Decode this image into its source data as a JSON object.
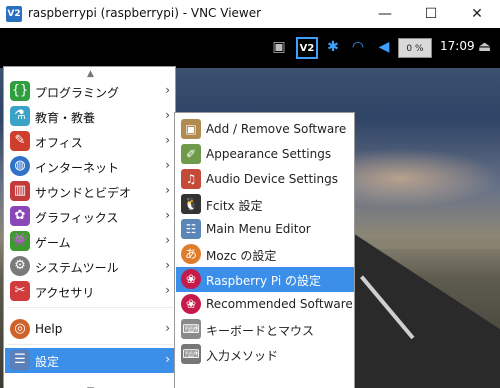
{
  "window": {
    "title": "raspberrypi (raspberrypi) - VNC Viewer",
    "app_icon_text": "V2",
    "minimize": "—",
    "maximize": "☐",
    "close": "✕"
  },
  "panel": {
    "vnc_icon_text": "V2",
    "cpu": "0 %",
    "clock": "17:09"
  },
  "main_menu": {
    "items": [
      {
        "label": "プログラミング",
        "icon": "programming-icon",
        "color": "#2e9e3e"
      },
      {
        "label": "教育・教養",
        "icon": "education-icon",
        "color": "#3aa4c8"
      },
      {
        "label": "オフィス",
        "icon": "office-icon",
        "color": "#cf3e2c"
      },
      {
        "label": "インターネット",
        "icon": "internet-icon",
        "color": "#2f72c8"
      },
      {
        "label": "サウンドとビデオ",
        "icon": "sound-video-icon",
        "color": "#c43a3a"
      },
      {
        "label": "グラフィックス",
        "icon": "graphics-icon",
        "color": "#8a47b8"
      },
      {
        "label": "ゲーム",
        "icon": "games-icon",
        "color": "#3c9b2c"
      },
      {
        "label": "システムツール",
        "icon": "system-tools-icon",
        "color": "#7a7a7a"
      },
      {
        "label": "アクセサリ",
        "icon": "accessories-icon",
        "color": "#d23b3b"
      },
      {
        "label": "Help",
        "icon": "help-icon",
        "color": "#d0612a"
      },
      {
        "label": "設定",
        "icon": "settings-icon",
        "color": "#5b7fb8"
      }
    ]
  },
  "submenu": {
    "items": [
      {
        "label": "Add / Remove Software",
        "icon": "package-icon",
        "color": "#b08a4f"
      },
      {
        "label": "Appearance Settings",
        "icon": "appearance-icon",
        "color": "#6f9a4c"
      },
      {
        "label": "Audio Device Settings",
        "icon": "audio-device-icon",
        "color": "#c44b3a"
      },
      {
        "label": "Fcitx 設定",
        "icon": "fcitx-icon",
        "color": "#333333"
      },
      {
        "label": "Main Menu Editor",
        "icon": "menu-editor-icon",
        "color": "#5a86b8"
      },
      {
        "label": "Mozc の設定",
        "icon": "mozc-icon",
        "color": "#e07b2a"
      },
      {
        "label": "Raspberry Pi の設定",
        "icon": "raspberry-icon",
        "color": "#c51a4a"
      },
      {
        "label": "Recommended Software",
        "icon": "recommended-icon",
        "color": "#c51a4a"
      },
      {
        "label": "キーボードとマウス",
        "icon": "keyboard-mouse-icon",
        "color": "#8a8a8a"
      },
      {
        "label": "入力メソッド",
        "icon": "input-method-icon",
        "color": "#777777"
      }
    ]
  },
  "colors": {
    "highlight": "#3b8fe8",
    "panel": "#000000"
  }
}
